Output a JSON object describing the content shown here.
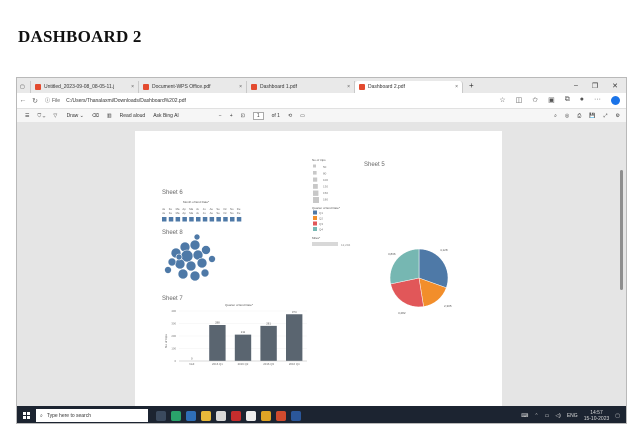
{
  "document": {
    "title": "DASHBOARD 2"
  },
  "browser": {
    "tabs": [
      {
        "label": "Untitled_2023-09-08_08-05-11.j"
      },
      {
        "label": "Document-WPS Office.pdf"
      },
      {
        "label": "Dashboard 1.pdf"
      },
      {
        "label": "Dashboard 2.pdf"
      }
    ],
    "new_tab": "+",
    "close": "×",
    "address": {
      "file_label": "File",
      "url": "C:/Users/Thanalaxmi/Downloads/Dashboard%202.pdf"
    },
    "pdf_toolbar": {
      "draw": "Draw",
      "read_aloud": "Read aloud",
      "ask_bing": "Ask Bing AI",
      "page_current": "1",
      "page_total": "of 1"
    }
  },
  "dashboard": {
    "sheet5": {
      "title": "Sheet 5"
    },
    "sheet6": {
      "title": "Sheet 6",
      "subtitle": "Month of End Date*",
      "months": [
        "Ja",
        "Fe",
        "Ma",
        "Ap",
        "Ma",
        "Ju",
        "Ju",
        "Au",
        "Se",
        "Oc",
        "No",
        "De"
      ],
      "colors": {
        "mark": "#4e79a7"
      }
    },
    "sheet8": {
      "title": "Sheet 8",
      "bubble_color": "#4e79a7"
    },
    "sheet7": {
      "title": "Sheet 7"
    },
    "legend": {
      "size_title": "No of trips",
      "size_values": [
        "50",
        "80",
        "100",
        "130",
        "150",
        "180"
      ],
      "color_title": "Quarter of End Date*",
      "quarters": [
        {
          "label": "Q1",
          "color": "#4e79a7"
        },
        {
          "label": "Q2",
          "color": "#f28e2b"
        },
        {
          "label": "Q3",
          "color": "#e15759"
        },
        {
          "label": "Q4",
          "color": "#76b7b2"
        }
      ],
      "miles_title": "Miles*",
      "miles_value": "12,204"
    }
  },
  "chart_data": [
    {
      "type": "bar",
      "title": "Quarter of End Date*",
      "ylabel": "No of trips",
      "categories": [
        "Null",
        "2016 Q1",
        "2016 Q2",
        "2016 Q3",
        "2016 Q4"
      ],
      "values": [
        0,
        288,
        211,
        281,
        374
      ],
      "ylim": [
        0,
        400
      ],
      "yticks": [
        "0",
        "100",
        "200",
        "300",
        "400"
      ],
      "color": "#5a6570"
    },
    {
      "type": "pie",
      "labels": [
        "4,128",
        "2,305",
        "3,282",
        "3,836"
      ],
      "values": [
        4128,
        2305,
        3282,
        3836
      ],
      "colors": [
        "#4e79a7",
        "#f28e2b",
        "#e15759",
        "#76b7b2"
      ]
    }
  ],
  "taskbar": {
    "search_placeholder": "Type here to search",
    "lang": "ENG",
    "time": "14:57",
    "date": "15-10-2023"
  }
}
